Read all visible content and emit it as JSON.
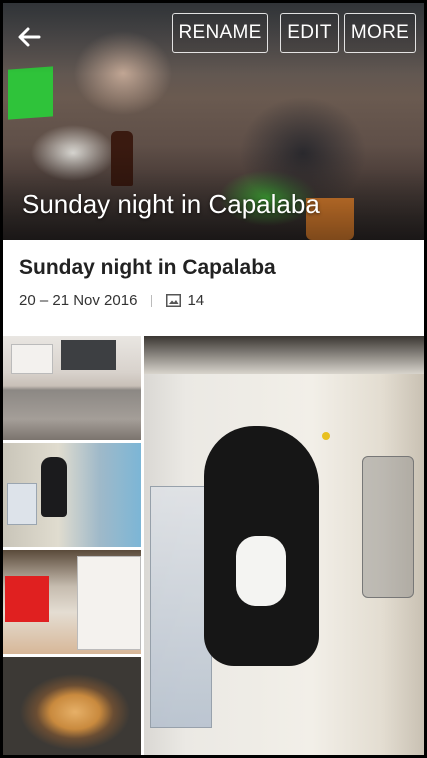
{
  "header": {
    "rename_label": "RENAME",
    "edit_label": "EDIT",
    "more_label": "MORE",
    "hero_title": "Sunday night in Capalaba"
  },
  "album": {
    "title": "Sunday night in Capalaba",
    "date_range": "20 – 21 Nov 2016",
    "image_count": "14"
  },
  "icons": {
    "back": "arrow-back-icon",
    "image_count": "image-icon"
  },
  "colors": {
    "title_text": "#222222",
    "button_border": "#ffffff"
  }
}
